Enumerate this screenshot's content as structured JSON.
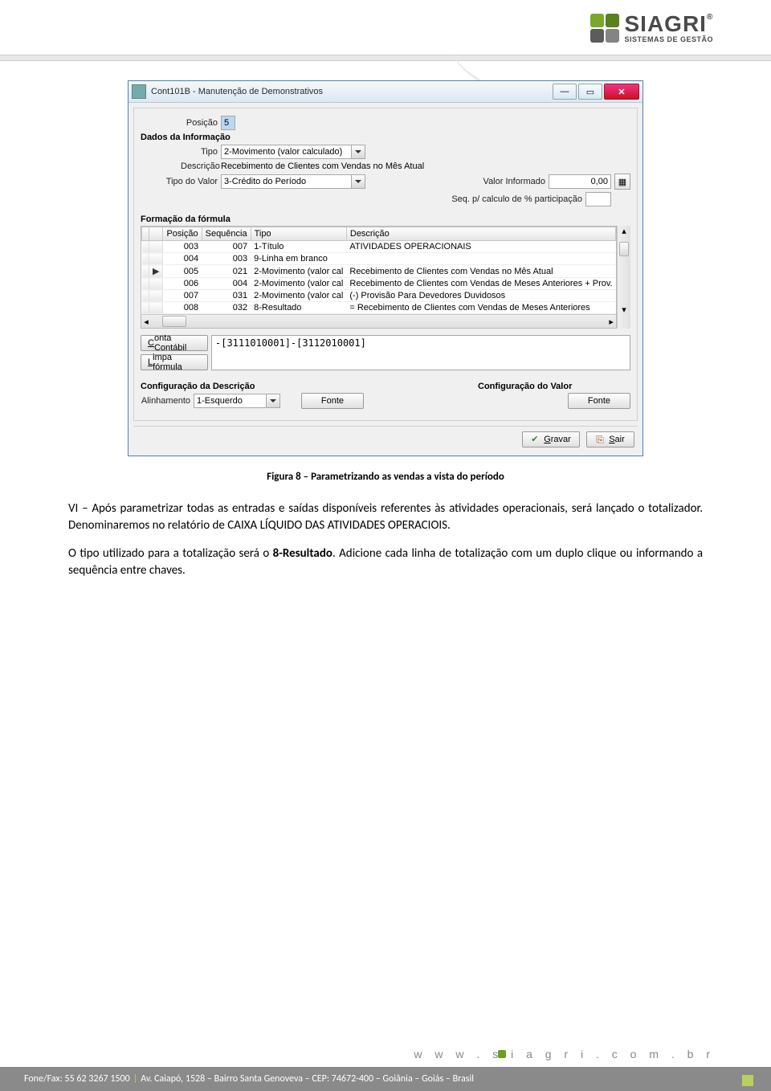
{
  "brand": {
    "word": "SIAGRI",
    "subtitle": "SISTEMAS DE GESTÃO",
    "reg": "®"
  },
  "window": {
    "title": "Cont101B - Manutenção de Demonstrativos",
    "tab": {
      "posicao_label": "Posição",
      "posicao_value": "5"
    },
    "sec_dados": "Dados da Informação",
    "tipo_label": "Tipo",
    "tipo_value": "2-Movimento (valor calculado)",
    "descricao_label": "Descrição",
    "descricao_value": "Recebimento de Clientes com Vendas no Mês Atual",
    "tipo_valor_label": "Tipo do Valor",
    "tipo_valor_value": "3-Crédito do Período",
    "valor_informado_label": "Valor Informado",
    "valor_informado_value": "0,00",
    "seq_label": "Seq. p/ calculo de % participação",
    "seq_value": "",
    "sec_formula": "Formação da fórmula",
    "grid_headers": [
      "Posição",
      "Sequência",
      "Tipo",
      "Descrição"
    ],
    "grid_rows": [
      {
        "pos": "003",
        "seq": "007",
        "tipo": "1-Título",
        "desc": "ATIVIDADES OPERACIONAIS",
        "cur": false
      },
      {
        "pos": "004",
        "seq": "003",
        "tipo": "9-Linha em branco",
        "desc": "",
        "cur": false
      },
      {
        "pos": "005",
        "seq": "021",
        "tipo": "2-Movimento (valor cal",
        "desc": "Recebimento de Clientes com Vendas no Mês Atual",
        "cur": true
      },
      {
        "pos": "006",
        "seq": "004",
        "tipo": "2-Movimento (valor cal",
        "desc": "Recebimento de Clientes com Vendas de Meses Anteriores + Prov.",
        "cur": false
      },
      {
        "pos": "007",
        "seq": "031",
        "tipo": "2-Movimento (valor cal",
        "desc": "(-) Provisão Para Devedores Duvidosos",
        "cur": false
      },
      {
        "pos": "008",
        "seq": "032",
        "tipo": "8-Resultado",
        "desc": "= Recebimento de Clientes com Vendas de Meses Anteriores",
        "cur": false
      }
    ],
    "conta_btn": "Conta Contábil",
    "limpa_btn": "Limpa fórmula",
    "formula": "-[3111010001]-[3112010001]",
    "cfg_desc": "Configuração da Descrição",
    "alinhamento_label": "Alinhamento",
    "alinhamento_value": "1-Esquerdo",
    "fonte_btn": "Fonte",
    "cfg_val": "Configuração do Valor",
    "gravar": "Gravar",
    "sair": "Sair"
  },
  "caption": "Figura 8 – Parametrizando as vendas a vista do período",
  "para1": "VI – Após parametrizar todas as entradas e saídas disponíveis referentes às atividades operacionais, será lançado o totalizador. Denominaremos no relatório de CAIXA LÍQUIDO DAS ATIVIDADES OPERACIOIS.",
  "para2a": "O tipo utilizado para a totalização será o ",
  "para2b": "8-Resultado",
  "para2c": ". Adicione cada linha de totalização com um duplo clique ou informando a sequência entre chaves.",
  "url": "w w w . s i a g r i . c o m . b r",
  "footer_fone": "Fone/Fax: 55 62 3267 1500",
  "footer_addr": "Av. Caiapó, 1528 – Bairro Santa Genoveva – CEP: 74672-400 – Goiânia – Goiás – Brasil"
}
